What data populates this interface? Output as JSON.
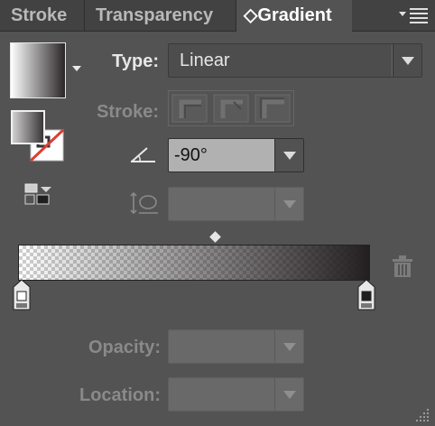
{
  "tabs": [
    {
      "label": "Stroke"
    },
    {
      "label": "Transparency"
    },
    {
      "label": "◇Gradient",
      "active": true
    }
  ],
  "panel_menu_icon": "panel-menu-icon",
  "type": {
    "label": "Type:",
    "value": "Linear"
  },
  "stroke": {
    "label": "Stroke:"
  },
  "angle": {
    "icon": "angle-icon",
    "value": "-90°"
  },
  "aspect_ratio": {
    "icon": "aspect-ratio-icon",
    "value": ""
  },
  "gradient": {
    "start_color": "#ffffff",
    "end_color": "#231f20"
  },
  "opacity": {
    "label": "Opacity:",
    "value": ""
  },
  "location": {
    "label": "Location:",
    "value": ""
  },
  "colors": {
    "panel": "#535353",
    "tabbar": "#424242",
    "field": "#b3b3b3",
    "field_dim": "#6a6a6a"
  }
}
